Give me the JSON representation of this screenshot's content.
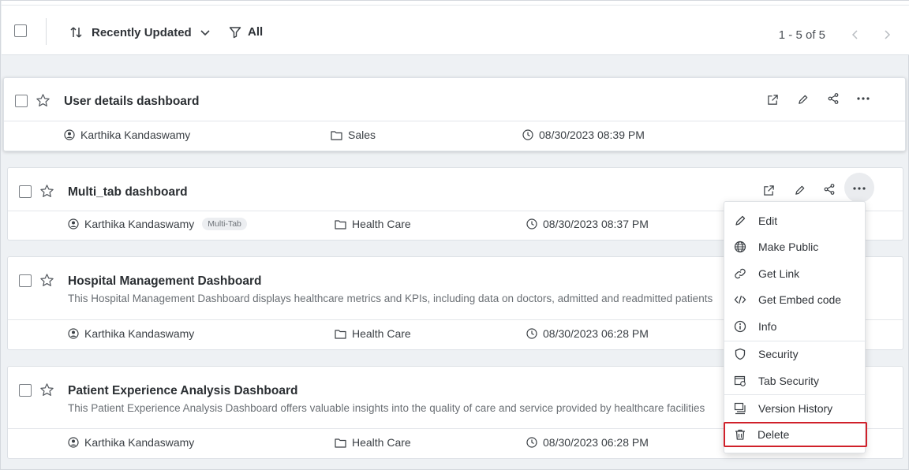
{
  "toolbar": {
    "sort_label": "Recently Updated",
    "filter_label": "All",
    "pagination": "1 - 5 of 5"
  },
  "dashboards": [
    {
      "title": "User details dashboard",
      "owner": "Karthika Kandaswamy",
      "category": "Sales",
      "updated": "08/30/2023 08:39 PM"
    },
    {
      "title": "Multi_tab dashboard",
      "owner": "Karthika Kandaswamy",
      "badge": "Multi-Tab",
      "category": "Health Care",
      "updated": "08/30/2023 08:37 PM"
    },
    {
      "title": "Hospital Management Dashboard",
      "description": "This Hospital Management Dashboard displays healthcare metrics and KPIs, including data on doctors, admitted and readmitted patients",
      "owner": "Karthika Kandaswamy",
      "category": "Health Care",
      "updated": "08/30/2023 06:28 PM"
    },
    {
      "title": "Patient Experience Analysis Dashboard",
      "description": "This Patient Experience Analysis Dashboard offers valuable insights into the quality of care and service provided by healthcare facilities",
      "owner": "Karthika Kandaswamy",
      "category": "Health Care",
      "updated": "08/30/2023 06:28 PM"
    }
  ],
  "context_menu": {
    "items": [
      "Edit",
      "Make Public",
      "Get Link",
      "Get Embed code",
      "Info",
      "Security",
      "Tab Security",
      "Version History",
      "Delete"
    ],
    "highlight_color": "#d0202a"
  }
}
